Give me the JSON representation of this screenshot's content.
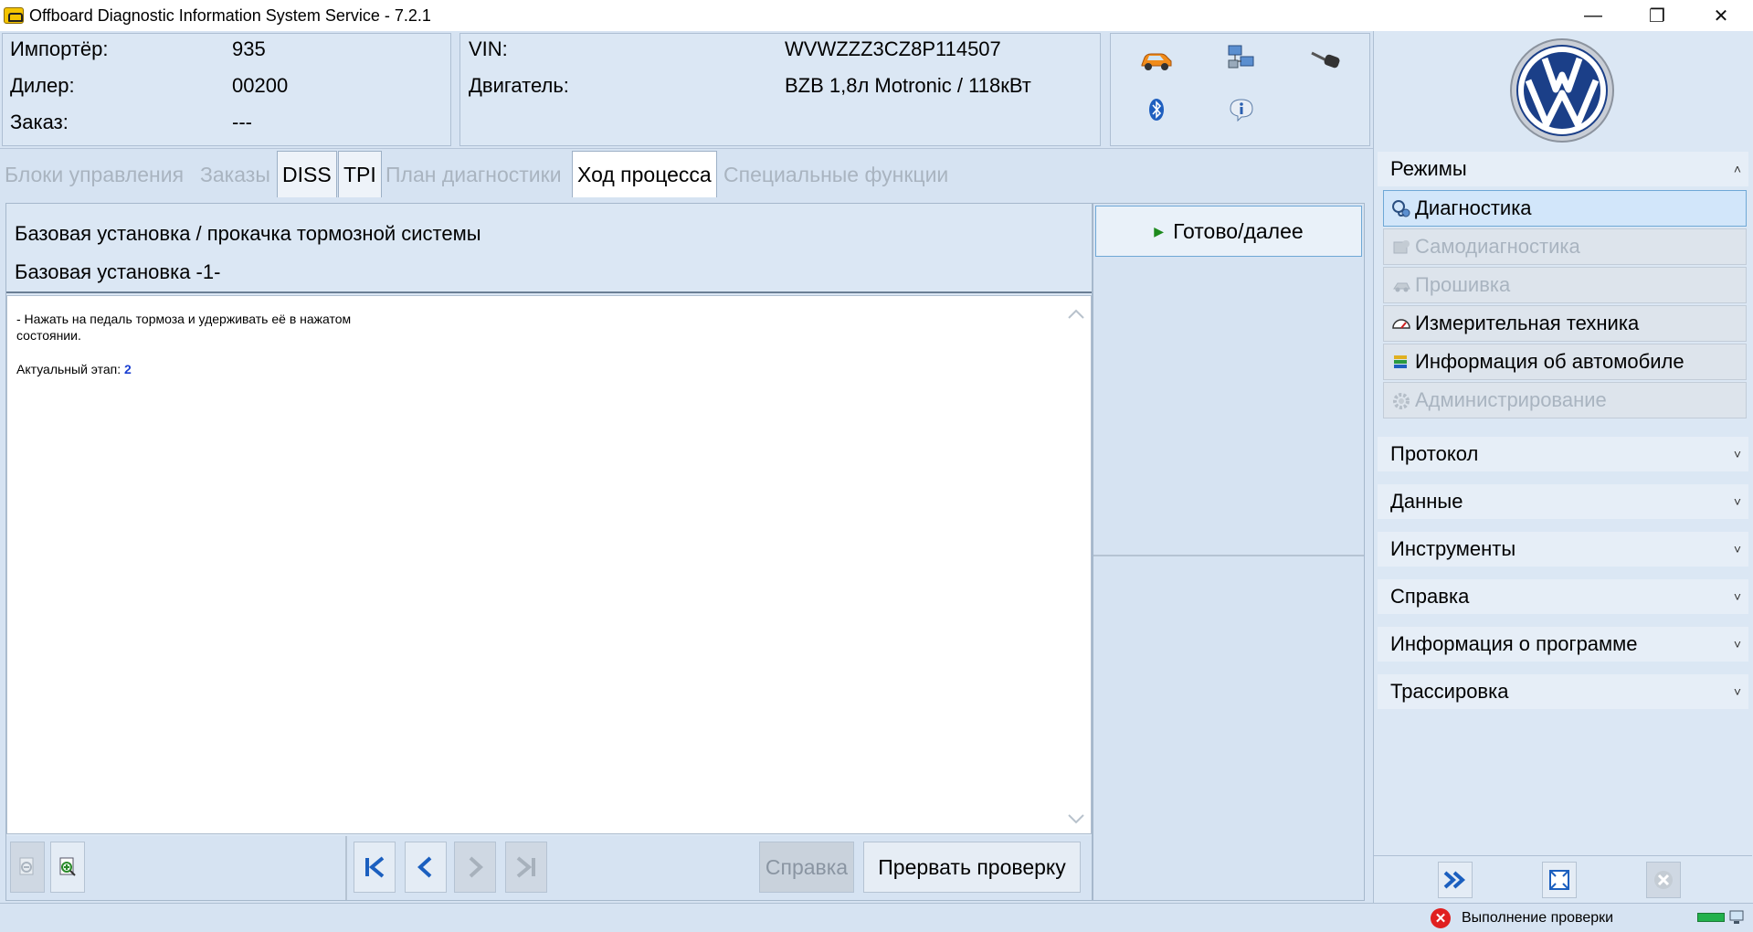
{
  "window": {
    "title": "Offboard Diagnostic Information System Service - 7.2.1",
    "controls": [
      "—",
      "❐",
      "✕"
    ]
  },
  "header": {
    "importer_label": "Импортёр:",
    "importer_value": "935",
    "dealer_label": "Дилер:",
    "dealer_value": "00200",
    "order_label": "Заказ:",
    "order_value": "---",
    "vin_label": "VIN:",
    "vin_value": "WVWZZZ3CZ8P114507",
    "engine_label": "Двигатель:",
    "engine_value": "BZB 1,8л Motronic / 118кВт",
    "icons": [
      "car-icon",
      "network-icon",
      "key-icon",
      "bluetooth-icon",
      "info-icon"
    ]
  },
  "tabs": [
    {
      "label": "Блоки управления",
      "state": "disabled"
    },
    {
      "label": "Заказы",
      "state": "disabled"
    },
    {
      "label": "DISS",
      "state": "enabled"
    },
    {
      "label": "TPI",
      "state": "enabled"
    },
    {
      "label": "План диагностики",
      "state": "disabled"
    },
    {
      "label": "Ход процесса",
      "state": "active"
    },
    {
      "label": "Специальные функции",
      "state": "disabled"
    }
  ],
  "step": {
    "title": "Базовая установка / прокачка тормозной системы",
    "subtitle": "Базовая установка -1-",
    "instruction": "- Нажать на педаль тормоза и удерживать её в нажатом состоянии.",
    "stage_label": "Актуальный этап:",
    "stage_value": "2"
  },
  "actions": {
    "ready_next": "Готово/далее",
    "help": "Справка",
    "abort": "Прервать проверку"
  },
  "right_panel": {
    "modes_title": "Режимы",
    "modes": [
      {
        "label": "Диагностика",
        "state": "selected",
        "icon": "stethoscope-icon"
      },
      {
        "label": "Самодиагностика",
        "state": "disabled",
        "icon": "self-diagnosis-icon"
      },
      {
        "label": "Прошивка",
        "state": "disabled",
        "icon": "flash-icon"
      },
      {
        "label": "Измерительная техника",
        "state": "enabled",
        "icon": "gauge-icon"
      },
      {
        "label": "Информация об автомобиле",
        "state": "enabled",
        "icon": "books-icon"
      },
      {
        "label": "Администрирование",
        "state": "disabled",
        "icon": "gear-icon"
      }
    ],
    "sections": [
      "Протокол",
      "Данные",
      "Инструменты",
      "Справка",
      "Информация о программе",
      "Трассировка"
    ]
  },
  "status": {
    "text": "Выполнение проверки"
  },
  "colors": {
    "panel_bg": "#d6e3f2",
    "accent_blue": "#1a3fd1",
    "selected_border": "#6fa8d6",
    "status_red": "#e02020"
  }
}
